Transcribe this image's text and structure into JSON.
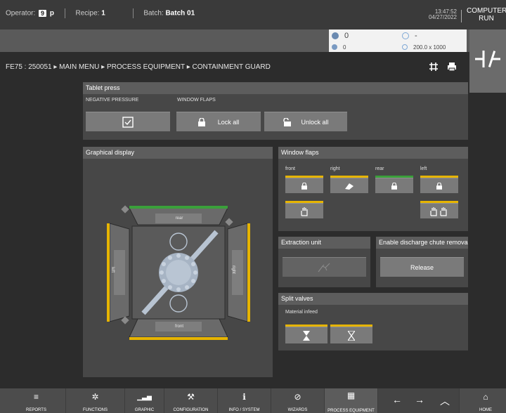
{
  "top": {
    "operator_label": "Operator:",
    "operator_badge": "9",
    "operator_suffix": "p",
    "recipe_label": "Recipe:",
    "recipe_value": "1",
    "batch_label": "Batch:",
    "batch_value": "Batch 01",
    "time": "13:47:52",
    "date": "04/27/2022",
    "status_line1": "COMPUTER",
    "status_line2": "RUN"
  },
  "counters": {
    "ok_main": "0",
    "ok_sub": "0",
    "time_main": "-",
    "time_sub": "200.0 x 1000"
  },
  "breadcrumb": "FE75 : 250051  ▸ MAIN MENU  ▸ PROCESS EQUIPMENT   ▸ CONTAINMENT GUARD",
  "tablet_press": {
    "title": "Tablet press",
    "neg_pressure_label": "NEGATIVE PRESSURE",
    "window_flaps_label": "WINDOW FLAPS",
    "lock_all": "Lock all",
    "unlock_all": "Unlock all"
  },
  "graphical": {
    "title": "Graphical display",
    "rear": "rear",
    "front": "front",
    "left": "left",
    "right": "right"
  },
  "window_flaps": {
    "title": "Window flaps",
    "front": "front",
    "right": "right",
    "rear": "rear",
    "left": "left"
  },
  "extraction": {
    "title": "Extraction unit"
  },
  "discharge": {
    "title": "Enable discharge chute remova",
    "release": "Release"
  },
  "split_valves": {
    "title": "Split valves",
    "material_infeed": "Material infeed"
  },
  "nav": [
    {
      "label": "REPORTS",
      "icon": "≡"
    },
    {
      "label": "FUNCTIONS",
      "icon": "✲"
    },
    {
      "label": "GRAPHIC",
      "icon": "▁▃▅"
    },
    {
      "label": "CONFIGURATION",
      "icon": "⚒"
    },
    {
      "label": "INFO / SYSTEM",
      "icon": "ℹ"
    },
    {
      "label": "WIZARDS",
      "icon": "⊘"
    },
    {
      "label": "PROCESS EQUIPMENT",
      "icon": "▦"
    },
    {
      "label": "HOME",
      "icon": "⌂"
    }
  ],
  "colors": {
    "accent_yellow": "#e6b400",
    "closed_green": "#3aa03a"
  }
}
